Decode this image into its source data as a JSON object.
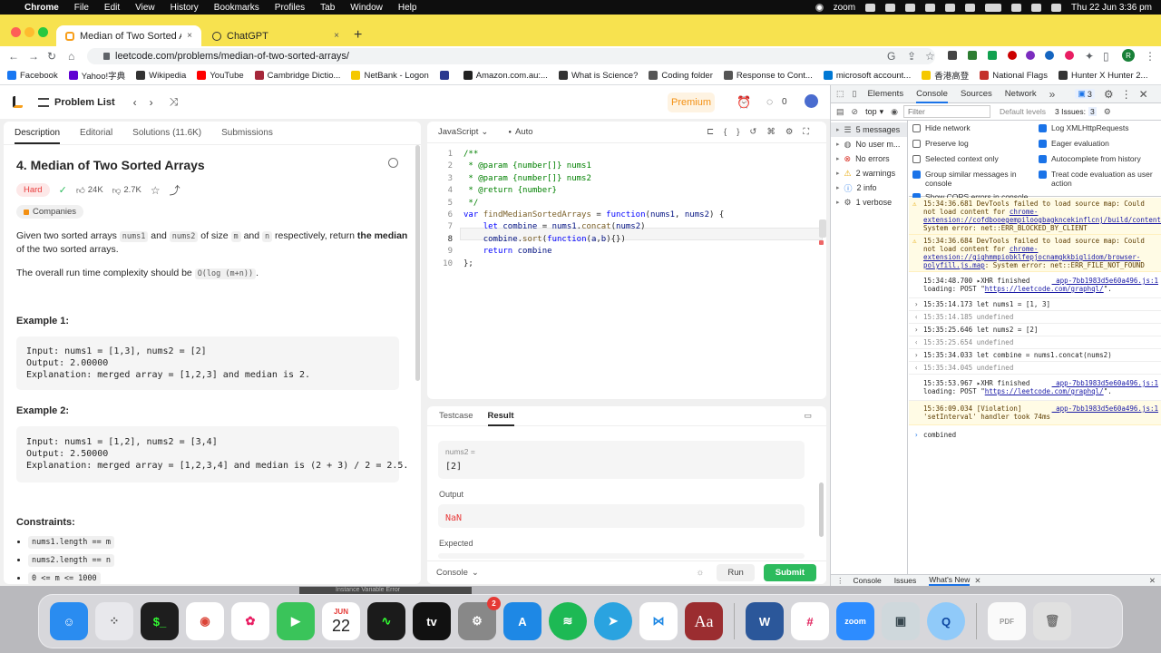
{
  "menubar": {
    "apple": "",
    "items": [
      "Chrome",
      "File",
      "Edit",
      "View",
      "History",
      "Bookmarks",
      "Profiles",
      "Tab",
      "Window",
      "Help"
    ],
    "zoom": "zoom",
    "datetime": "Thu 22 Jun  3:36 pm"
  },
  "browser": {
    "tabs": [
      {
        "title": "Median of Two Sorted Arrays -",
        "close": "×"
      },
      {
        "title": "ChatGPT",
        "close": "×"
      }
    ],
    "new_tab": "+",
    "url": "leetcode.com/problems/median-of-two-sorted-arrays/",
    "profile_initial": "R",
    "bookmarks": [
      {
        "label": "Facebook",
        "color": "#1877f2"
      },
      {
        "label": "Yahoo!字典",
        "color": "#6001d2"
      },
      {
        "label": "Wikipedia",
        "color": "#333333"
      },
      {
        "label": "YouTube",
        "color": "#ff0000"
      },
      {
        "label": "Cambridge Dictio...",
        "color": "#a5273a"
      },
      {
        "label": "NetBank - Logon",
        "color": "#f5c800"
      },
      {
        "label": "",
        "color": "#2b3990"
      },
      {
        "label": "Amazon.com.au:...",
        "color": "#222222"
      },
      {
        "label": "What is Science?",
        "color": "#333333"
      },
      {
        "label": "Coding folder",
        "color": "#555555"
      },
      {
        "label": "Response to Cont...",
        "color": "#555555"
      },
      {
        "label": "microsoft account...",
        "color": "#0078d4"
      },
      {
        "label": "香港高登",
        "color": "#f5c800"
      },
      {
        "label": "National Flags",
        "color": "#c4302b"
      },
      {
        "label": "Hunter X Hunter 2...",
        "color": "#333333"
      }
    ]
  },
  "leetcode": {
    "header": {
      "problem_list": "Problem List",
      "premium": "Premium",
      "streak": "0"
    },
    "left_tabs": [
      "Description",
      "Editorial",
      "Solutions (11.6K)",
      "Submissions"
    ],
    "title": "4. Median of Two Sorted Arrays",
    "difficulty": "Hard",
    "likes": "24K",
    "dislikes": "2.7K",
    "companies": "Companies",
    "desc": {
      "p1a": "Given two sorted arrays ",
      "c1": "nums1",
      "p1b": " and ",
      "c2": "nums2",
      "p1c": " of size ",
      "c3": "m",
      "p1d": " and ",
      "c4": "n",
      "p1e": " respectively, return ",
      "p1bold": "the median",
      "p1f": " of the two sorted arrays.",
      "p2a": "The overall run time complexity should be ",
      "c5": "O(log (m+n))",
      "p2b": "."
    },
    "examples": [
      {
        "heading": "Example 1:",
        "body": "Input: nums1 = [1,3], nums2 = [2]\nOutput: 2.00000\nExplanation: merged array = [1,2,3] and median is 2."
      },
      {
        "heading": "Example 2:",
        "body": "Input: nums1 = [1,2], nums2 = [3,4]\nOutput: 2.50000\nExplanation: merged array = [1,2,3,4] and median is (2 + 3) / 2 = 2.5."
      }
    ],
    "constraints_heading": "Constraints:",
    "constraints": [
      "nums1.length == m",
      "nums2.length == n",
      "0 <= m <= 1000"
    ],
    "editor": {
      "language": "JavaScript",
      "mode": "Auto",
      "line_numbers": [
        "1",
        "2",
        "3",
        "4",
        "5",
        "6",
        "7",
        "8",
        "9",
        "10"
      ],
      "current_line": 8
    },
    "bottom": {
      "tabs": [
        "Testcase",
        "Result"
      ],
      "input_label": "nums2 =",
      "input_value": "[2]",
      "output_label": "Output",
      "output_value": "NaN",
      "expected_label": "Expected",
      "console": "Console",
      "run": "Run",
      "submit": "Submit"
    }
  },
  "devtools": {
    "tabs": [
      "Elements",
      "Console",
      "Sources",
      "Network"
    ],
    "issues_badge": "3",
    "context": "top",
    "filter_placeholder": "Filter",
    "levels": "Default levels",
    "issues": "3 Issues:",
    "issues_count": "3",
    "sidebar": [
      {
        "label": "5 messages",
        "icon": "list-icon"
      },
      {
        "label": "No user m...",
        "icon": "user-icon"
      },
      {
        "label": "No errors",
        "icon": "error-icon"
      },
      {
        "label": "2 warnings",
        "icon": "warning-icon"
      },
      {
        "label": "2 info",
        "icon": "info-icon"
      },
      {
        "label": "1 verbose",
        "icon": "gear-icon"
      }
    ],
    "options_left": [
      {
        "label": "Hide network",
        "checked": false
      },
      {
        "label": "Preserve log",
        "checked": false
      },
      {
        "label": "Selected context only",
        "checked": false
      },
      {
        "label": "Group similar messages in console",
        "checked": true
      },
      {
        "label": "Show CORS errors in console",
        "checked": true
      }
    ],
    "options_right": [
      {
        "label": "Log XMLHttpRequests",
        "checked": true
      },
      {
        "label": "Eager evaluation",
        "checked": true
      },
      {
        "label": "Autocomplete from history",
        "checked": true
      },
      {
        "label": "Treat code evaluation as user action",
        "checked": true
      }
    ],
    "drawer_tabs": [
      "Console",
      "Issues",
      "What's New"
    ],
    "console_prompt": "combined"
  },
  "dock": {
    "calendar_month": "JUN",
    "calendar_day": "22",
    "settings_badge": "2",
    "tooltip": "Instance Variable Error"
  }
}
